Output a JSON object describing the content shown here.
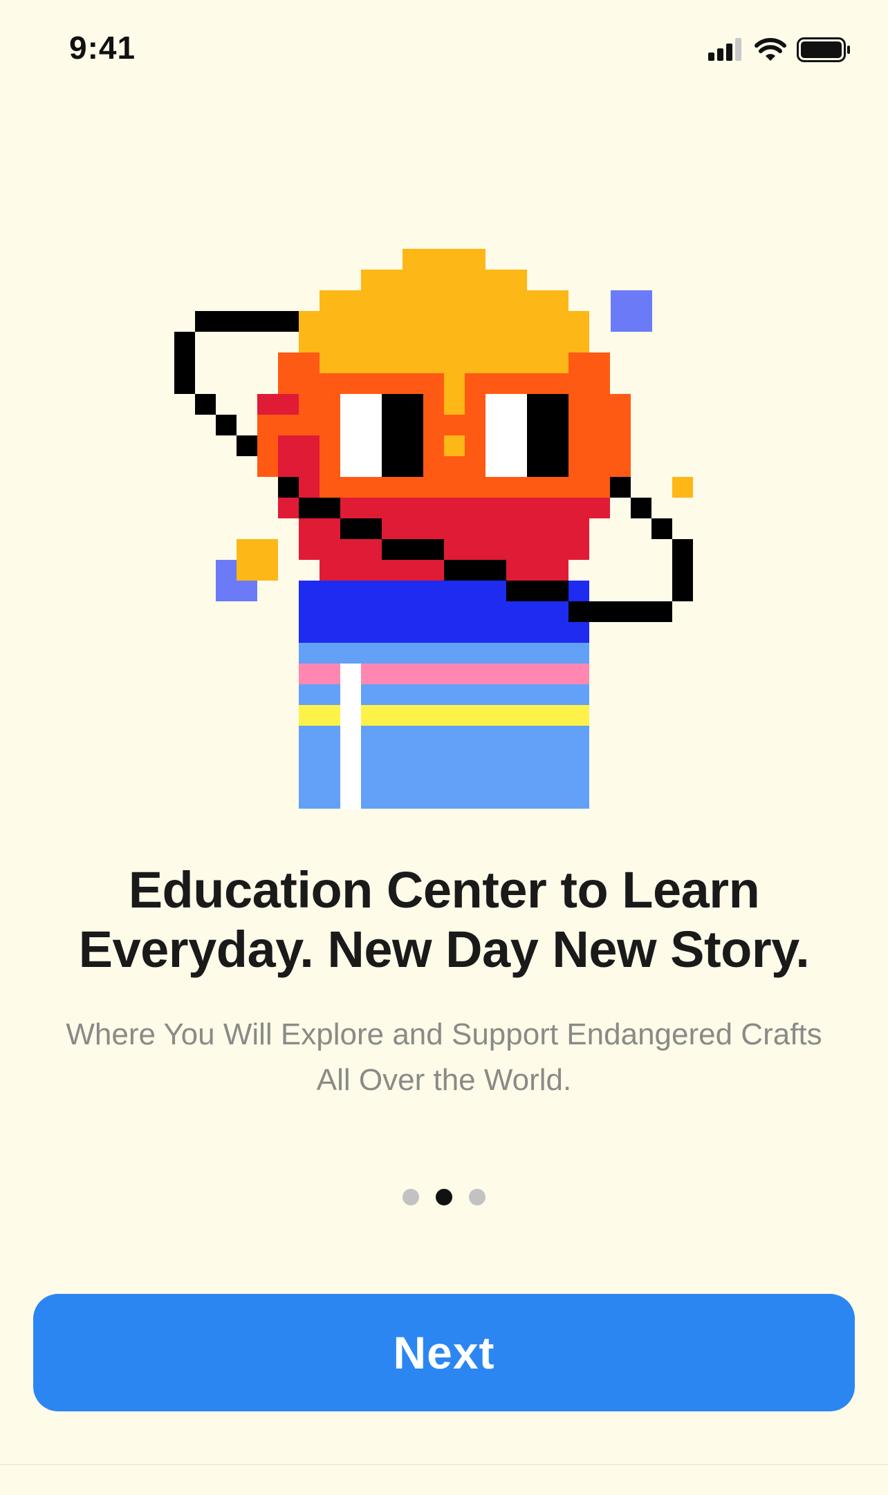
{
  "status_bar": {
    "time": "9:41"
  },
  "onboarding": {
    "headline_line1": "Education Center to Learn",
    "headline_line2": "Everyday. New Day New Story.",
    "subtitle_line1": "Where You Will Explore and Support Endangered Crafts",
    "subtitle_line2": "All Over the World.",
    "page_count": 3,
    "current_page": 2,
    "next_label": "Next"
  },
  "colors": {
    "background": "#FEFBE9",
    "button": "#2B86F2",
    "helmet": "#FDB716",
    "face": "#FF5A14",
    "scarf": "#E01B36",
    "shirt_blue": "#1E2BF0",
    "pants": "#63A0F8",
    "stripe_pink": "#FF87B2",
    "stripe_yellow": "#FDF249",
    "accent_purple": "#6B7BF7"
  },
  "icons": [
    "signal-icon",
    "wifi-icon",
    "battery-icon"
  ]
}
